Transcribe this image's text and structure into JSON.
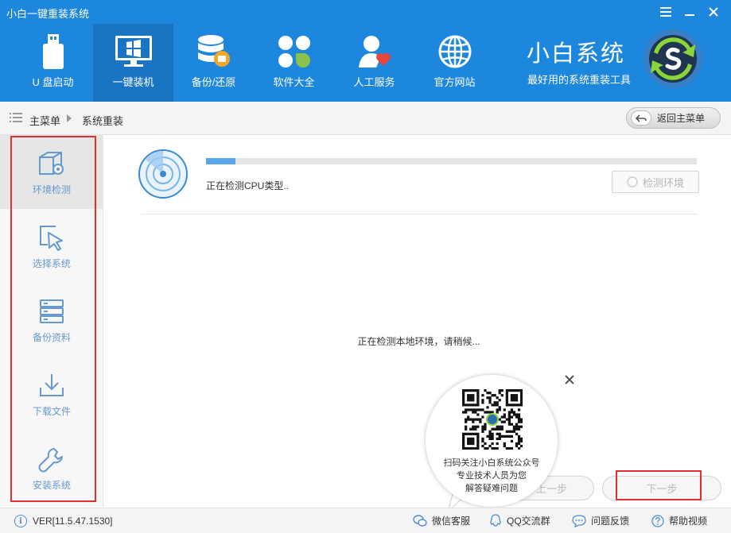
{
  "window": {
    "title": "小白一键重装系统",
    "controls": [
      "menu-icon",
      "minimize-icon",
      "close-icon"
    ]
  },
  "nav": {
    "items": [
      {
        "label": "U 盘启动",
        "icon": "usb-drive-icon"
      },
      {
        "label": "一键装机",
        "icon": "monitor-windows-icon",
        "active": true
      },
      {
        "label": "备份/还原",
        "icon": "database-backup-icon"
      },
      {
        "label": "软件大全",
        "icon": "apps-grid-icon"
      },
      {
        "label": "人工服务",
        "icon": "person-heart-icon"
      },
      {
        "label": "官方网站",
        "icon": "globe-icon"
      }
    ]
  },
  "brand": {
    "title": "小白系统",
    "subtitle": "最好用的系统重装工具"
  },
  "breadcrumb": {
    "root": "主菜单",
    "current": "系统重装",
    "back_label": "返回主菜单"
  },
  "steps": [
    {
      "label": "环境检测",
      "icon": "environment-check-icon",
      "active": true
    },
    {
      "label": "选择系统",
      "icon": "select-cursor-icon"
    },
    {
      "label": "备份资料",
      "icon": "backup-stack-icon"
    },
    {
      "label": "下载文件",
      "icon": "download-icon"
    },
    {
      "label": "安装系统",
      "icon": "wrench-icon"
    }
  ],
  "main": {
    "progress": 0.06,
    "status_cpu": "正在检测CPU类型..",
    "detect_button": "检测环境",
    "status_local": "正在检测本地环境，请稍候...",
    "prev_label": "上一步",
    "next_label": "下一步"
  },
  "qr_popup": {
    "lines": [
      "扫码关注小白系统公众号",
      "专业技术人员为您",
      "解答疑难问题"
    ]
  },
  "footer": {
    "version": "VER[11.5.47.1530]",
    "links": [
      {
        "label": "微信客服",
        "icon": "wechat-icon"
      },
      {
        "label": "QQ交流群",
        "icon": "qq-icon"
      },
      {
        "label": "问题反馈",
        "icon": "feedback-icon"
      },
      {
        "label": "帮助视频",
        "icon": "help-icon"
      }
    ]
  },
  "colors": {
    "header_blue": "#1d86dd",
    "active_nav": "#1a74c4",
    "step_label": "#6699cc",
    "highlight_red": "#e23030",
    "progress_fill": "#5aa6e8"
  }
}
